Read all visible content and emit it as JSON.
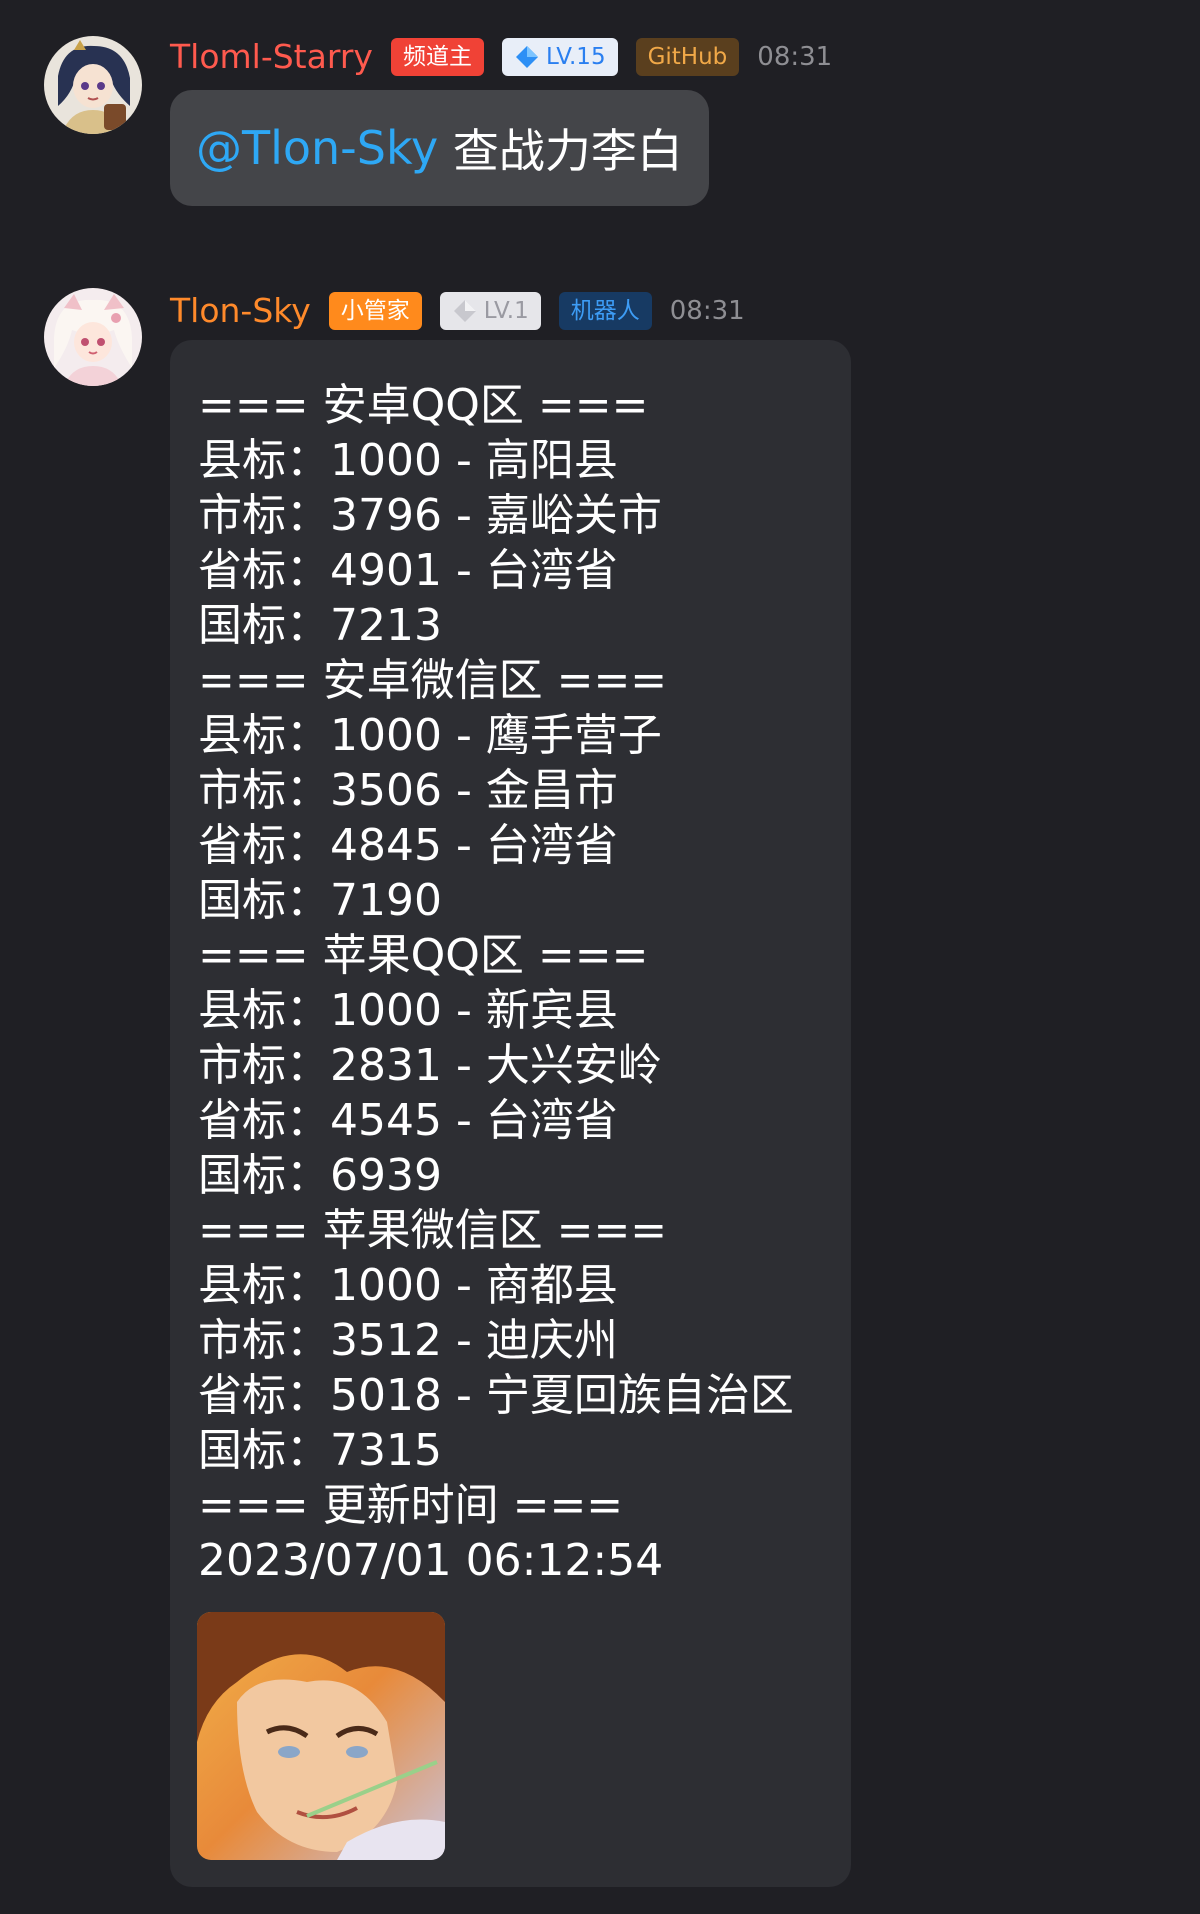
{
  "messages": [
    {
      "sender": "Tloml-Starry",
      "badges": {
        "role": "频道主",
        "level": "LV.15",
        "tag": "GitHub"
      },
      "time": "08:31",
      "mention": "@Tlon-Sky",
      "text": " 查战力李白"
    },
    {
      "sender": "Tlon-Sky",
      "badges": {
        "role": "小管家",
        "level": "LV.1",
        "tag": "机器人"
      },
      "time": "08:31",
      "lines": [
        "=== 安卓QQ区 ===",
        "县标：1000 - 高阳县",
        "市标：3796 - 嘉峪关市",
        "省标：4901 - 台湾省",
        "国标：7213",
        "=== 安卓微信区 ===",
        "县标：1000 - 鹰手营子",
        "市标：3506 - 金昌市",
        "省标：4845 - 台湾省",
        "国标：7190",
        "=== 苹果QQ区 ===",
        "县标：1000 - 新宾县",
        "市标：2831 - 大兴安岭",
        "省标：4545 - 台湾省",
        "国标：6939",
        "=== 苹果微信区 ===",
        "县标：1000 - 商都县",
        "市标：3512 - 迪庆州",
        "省标：5018 - 宁夏回族自治区",
        "国标：7315",
        "=== 更新时间 ===",
        "2023/07/01 06:12:54"
      ]
    }
  ],
  "colors": {
    "background": "#1f1f24",
    "sender1": "#ff5a4e",
    "sender2": "#ff8a2b",
    "mention": "#2ea8f5",
    "role_red": "#f04236",
    "role_orange": "#ff8a1c",
    "github_bg": "#5a3f1e",
    "github_text": "#f0a848",
    "bot_bg": "#173a63",
    "bot_text": "#3d9cf5"
  },
  "icons": [
    "diamond-level-icon",
    "gray-diamond-level-icon",
    "avatar-image",
    "hero-image"
  ]
}
